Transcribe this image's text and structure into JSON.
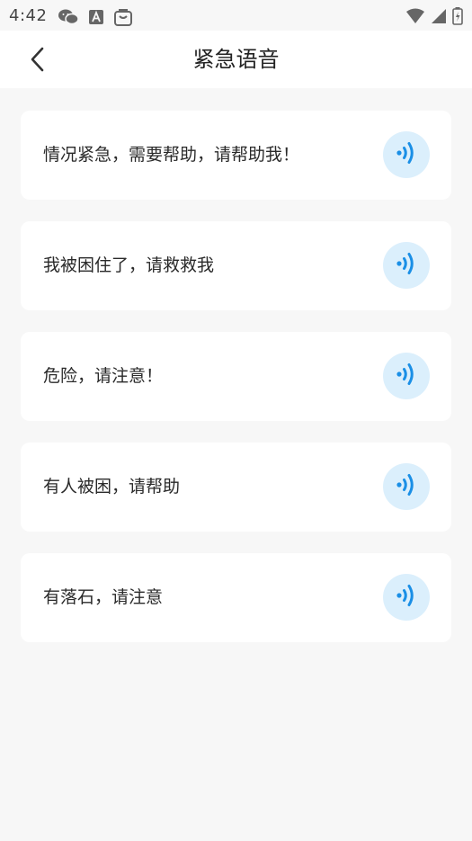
{
  "status_bar": {
    "time": "4:42",
    "left_icons": [
      "wechat-icon",
      "font-a-icon",
      "store-icon"
    ],
    "right_icons": [
      "wifi-icon",
      "signal-icon",
      "battery-charging-icon"
    ]
  },
  "header": {
    "back_icon": "chevron-left-icon",
    "title": "紧急语音"
  },
  "phrases": [
    {
      "text": "情况紧急，需要帮助，请帮助我！",
      "icon": "speaker-wave-icon"
    },
    {
      "text": "我被困住了，请救救我",
      "icon": "speaker-wave-icon"
    },
    {
      "text": "危险，请注意！",
      "icon": "speaker-wave-icon"
    },
    {
      "text": "有人被困，请帮助",
      "icon": "speaker-wave-icon"
    },
    {
      "text": "有落石，请注意",
      "icon": "speaker-wave-icon"
    }
  ],
  "colors": {
    "accent": "#1a8fe6",
    "button_bg": "#dbeffc",
    "page_bg": "#f7f7f7",
    "card_bg": "#ffffff"
  }
}
